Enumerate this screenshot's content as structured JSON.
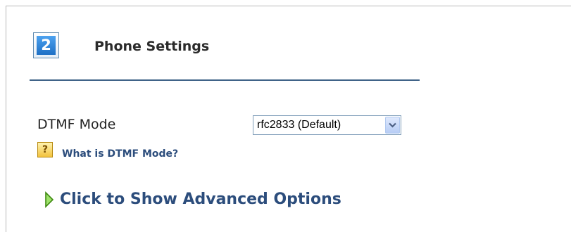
{
  "section": {
    "step_number": "2",
    "title": "Phone Settings"
  },
  "dtmf": {
    "label": "DTMF Mode",
    "selected_value": "rfc2833 (Default)",
    "help_icon_glyph": "?",
    "help_link": "What is DTMF Mode?"
  },
  "advanced": {
    "toggle_label": "Click to Show Advanced Options"
  },
  "icons": {
    "step": "step-number-icon",
    "dropdown": "chevron-down-icon",
    "help": "help-icon",
    "expand": "triangle-right-icon"
  },
  "colors": {
    "accent_blue": "#2c4d7c",
    "rule": "#3f6287",
    "step_blue": "#1d6fc5",
    "help_yellow": "#f2c23d",
    "expand_green": "#4a9a1a"
  }
}
